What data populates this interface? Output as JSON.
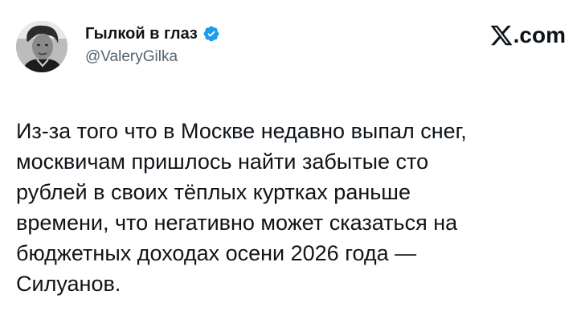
{
  "author": {
    "name": "Гылкой в глаз",
    "handle": "@ValeryGilka",
    "verified": true,
    "verified_color": "#1d9bf0"
  },
  "brand": {
    "domain": ".com",
    "logo_icon": "x-logo-icon"
  },
  "tweet": {
    "lines": [
      "Из-за того что в Москве недавно выпал снег,",
      "москвичам пришлось найти забытые сто",
      "рублей в своих тёплых куртках раньше",
      "времени, что негативно может сказаться на",
      "бюджетных доходах осени 2026 года —",
      "Силуанов."
    ]
  },
  "colors": {
    "text": "#0f1419",
    "secondary_text": "#536471",
    "background": "#ffffff"
  }
}
